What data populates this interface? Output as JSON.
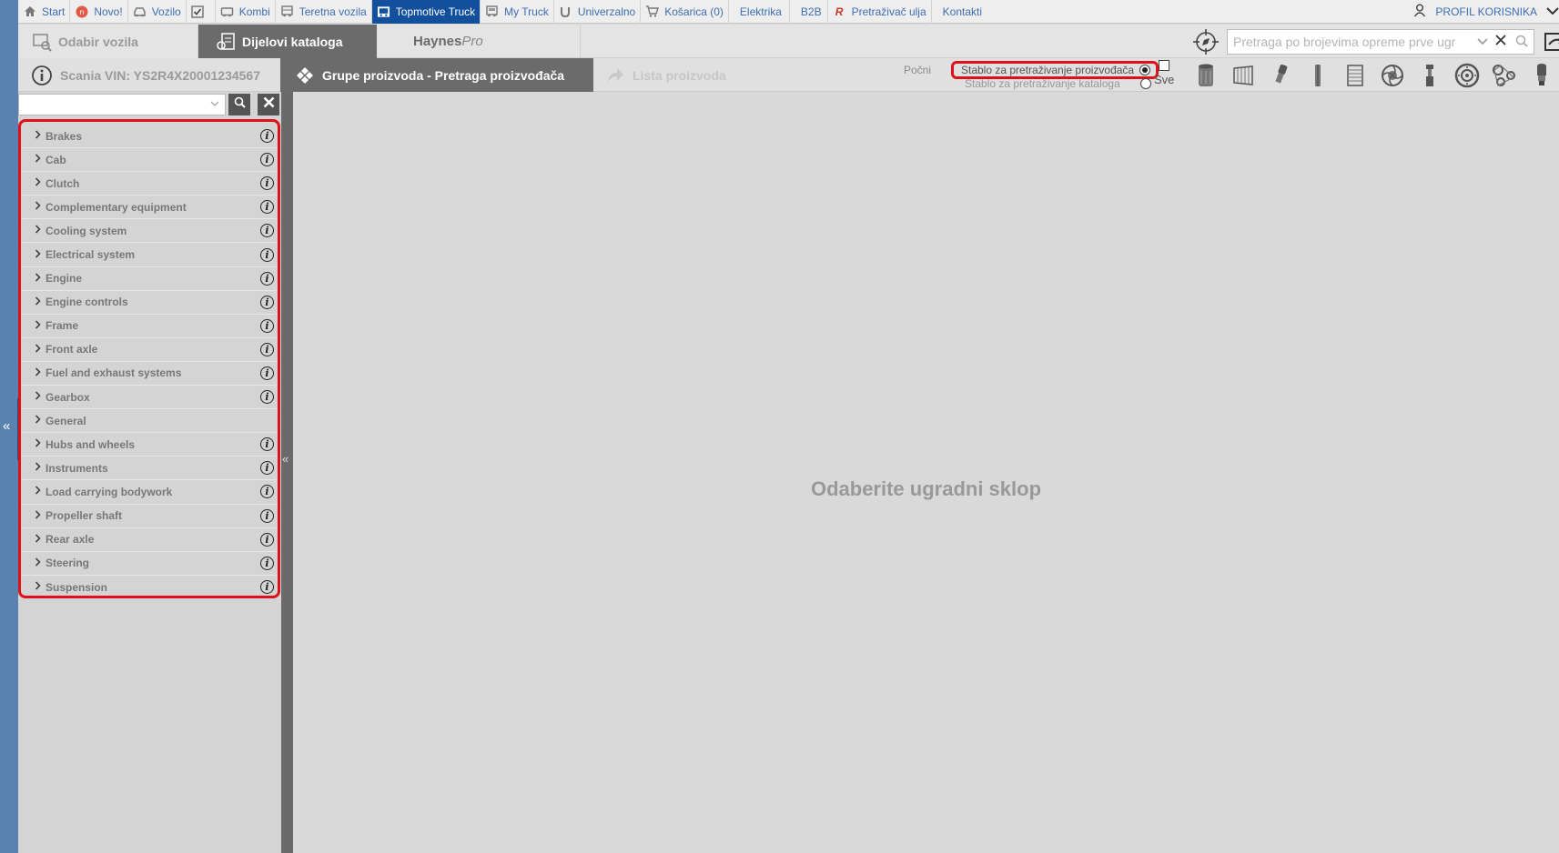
{
  "topnav": {
    "items": [
      {
        "label": "Start",
        "icon": "home-icon"
      },
      {
        "label": "Novo!",
        "icon": "new-badge-icon"
      },
      {
        "label": "Vozilo",
        "icon": "car-icon"
      },
      {
        "label": "",
        "icon": "check-icon"
      },
      {
        "label": "Kombi",
        "icon": "van-icon"
      },
      {
        "label": "Teretna vozila",
        "icon": "truck-icon"
      },
      {
        "label": "Topmotive Truck",
        "icon": "truck-logo-icon",
        "active": true
      },
      {
        "label": "My Truck",
        "icon": "truck-small-icon"
      },
      {
        "label": "Univerzalno",
        "icon": "wrench-icon"
      },
      {
        "label": "Košarica (0)",
        "icon": "cart-icon"
      },
      {
        "label": "Elektrika",
        "icon": ""
      },
      {
        "label": "B2B",
        "icon": ""
      },
      {
        "label": "Pretraživač ulja",
        "icon": "oil-r-icon"
      },
      {
        "label": "Kontakti",
        "icon": ""
      }
    ],
    "profile_label": "PROFIL KORISNIKA"
  },
  "tabs": {
    "odabir": "Odabir vozila",
    "dijelovi": "Dijelovi kataloga",
    "haynes_main": "Haynes",
    "haynes_suffix": "Pro"
  },
  "search": {
    "placeholder": "Pretraga po brojevima opreme prve ugr",
    "value": ""
  },
  "subbar": {
    "vin_label": "Scania VIN: YS2R4X20001234567",
    "grupe_label": "Grupe proizvoda - Pretraga proizvođača",
    "lista_label": "Lista proizvoda",
    "pocni_label": "Počni",
    "tree_option_1": "Stablo za pretraživanje proizvođača",
    "tree_option_2": "Stablo za pretraživanje kataloga",
    "sve_label": "Sve"
  },
  "category_icons": [
    "oil-filter-icon",
    "air-filter-icon",
    "spark-plug-icon",
    "wiper-blade-icon",
    "radiator-icon",
    "turbo-icon",
    "shock-absorber-icon",
    "brake-disc-icon",
    "timing-belt-icon",
    "bulb-icon"
  ],
  "sidebar": {
    "filter_value": "",
    "groups": [
      {
        "label": "Brakes",
        "info": true
      },
      {
        "label": "Cab",
        "info": true
      },
      {
        "label": "Clutch",
        "info": true
      },
      {
        "label": "Complementary equipment",
        "info": true
      },
      {
        "label": "Cooling system",
        "info": true
      },
      {
        "label": "Electrical system",
        "info": true
      },
      {
        "label": "Engine",
        "info": true
      },
      {
        "label": "Engine controls",
        "info": true
      },
      {
        "label": "Frame",
        "info": true
      },
      {
        "label": "Front axle",
        "info": true
      },
      {
        "label": "Fuel and exhaust systems",
        "info": true
      },
      {
        "label": "Gearbox",
        "info": true
      },
      {
        "label": "General",
        "info": false
      },
      {
        "label": "Hubs and wheels",
        "info": true
      },
      {
        "label": "Instruments",
        "info": true
      },
      {
        "label": "Load carrying bodywork",
        "info": true
      },
      {
        "label": "Propeller shaft",
        "info": true
      },
      {
        "label": "Rear axle",
        "info": true
      },
      {
        "label": "Steering",
        "info": true
      },
      {
        "label": "Suspension",
        "info": true
      }
    ]
  },
  "main": {
    "empty_message": "Odaberite ugradni sklop"
  },
  "colors": {
    "accent_blue": "#124f9c",
    "highlight_red": "#e0101a",
    "link_blue": "#3d6fb3"
  }
}
